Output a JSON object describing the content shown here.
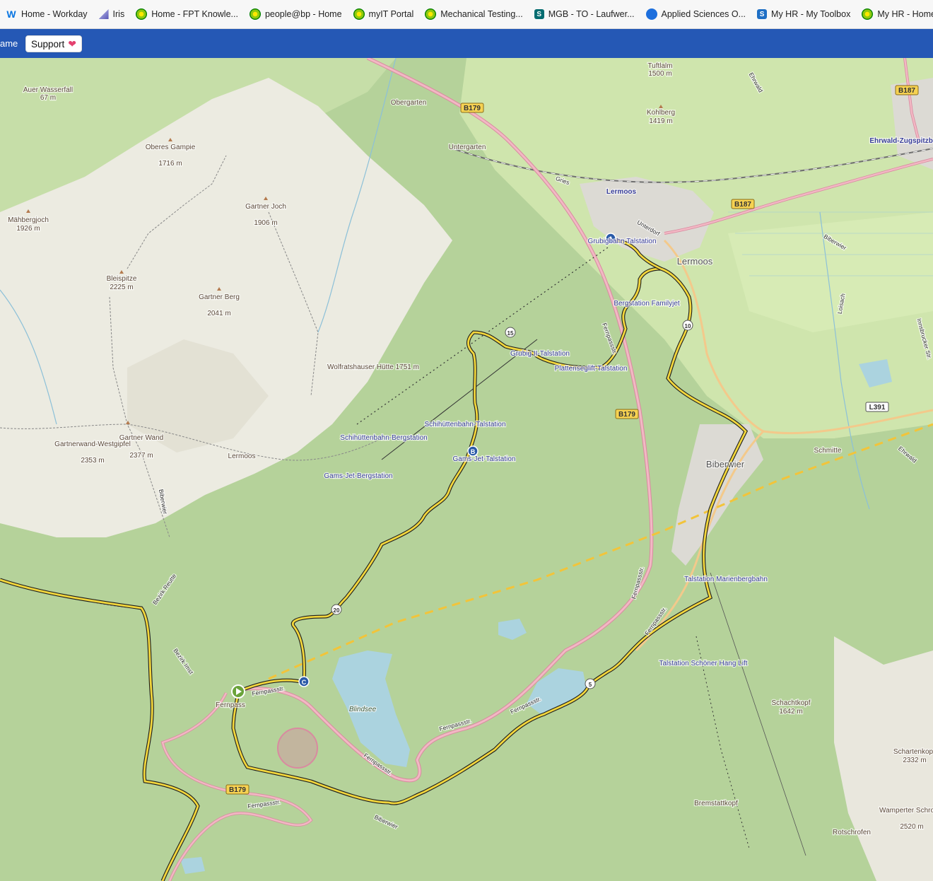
{
  "bookmarks": [
    {
      "label": "Home - Workday",
      "icon": "workday-icon"
    },
    {
      "label": "Iris",
      "icon": "iris-icon"
    },
    {
      "label": "Home - FPT Knowle...",
      "icon": "bp-icon"
    },
    {
      "label": "people@bp - Home",
      "icon": "bp-icon"
    },
    {
      "label": "myIT Portal",
      "icon": "bp-icon"
    },
    {
      "label": "Mechanical Testing...",
      "icon": "bp-icon"
    },
    {
      "label": "MGB - TO - Laufwer...",
      "icon": "sharepoint-icon"
    },
    {
      "label": "Applied Sciences O...",
      "icon": "globe-icon"
    },
    {
      "label": "My HR - My Toolbox",
      "icon": "sharepoint-icon"
    },
    {
      "label": "My HR - Home",
      "icon": "bp-icon"
    }
  ],
  "appbar": {
    "left_text": "ame",
    "support_label": "Support",
    "support_icon": "heart-icon",
    "color": "#2558b5"
  },
  "map": {
    "route_color": "#f2d63c",
    "markers": [
      {
        "id": "A",
        "label": "A",
        "type": "waypoint"
      },
      {
        "id": "B",
        "label": "B",
        "type": "waypoint"
      },
      {
        "id": "C",
        "label": "C",
        "type": "waypoint"
      },
      {
        "id": "start",
        "label": "",
        "type": "start-icon"
      }
    ],
    "km_markers": [
      "5",
      "10",
      "15",
      "20"
    ],
    "road_shields": [
      "B179",
      "B179",
      "B179",
      "B187",
      "B187",
      "L391"
    ],
    "peaks": [
      {
        "name": "Tuftlalm",
        "elev": "1500 m"
      },
      {
        "name": "Kohlberg",
        "elev": "1419 m"
      },
      {
        "name": "Oberes Gampie",
        "elev": "1716 m"
      },
      {
        "name": "Gartner Joch",
        "elev": "1906 m"
      },
      {
        "name": "Mähbergjoch",
        "elev": "1926 m"
      },
      {
        "name": "Bleispitze",
        "elev": "2225 m"
      },
      {
        "name": "Gartner Berg",
        "elev": "2041 m"
      },
      {
        "name": "Gartnerwand-Westgipfel",
        "elev": "2353 m"
      },
      {
        "name": "Gartner Wand",
        "elev": "2377 m"
      },
      {
        "name": "Schachtkopf",
        "elev": "1642 m"
      },
      {
        "name": "Schartenkop",
        "elev": "2332 m"
      },
      {
        "name": "Wamperter Schrofen",
        "elev": "2520 m"
      },
      {
        "name": "Auer Wasserfall",
        "elev": "67 m"
      }
    ],
    "places": [
      "Obergarten",
      "Untergarten",
      "Lermoos",
      "Lermoos",
      "Biberwier",
      "Schmitte",
      "Ehrwald-Zugspitzbahn",
      "Fernpass",
      "Gries",
      "Unterdorf",
      "Bremstattkopf",
      "Rotschrofen",
      "Blindsee",
      "Lermoos"
    ],
    "stations": [
      "Grubigbahn Talstation",
      "Bergstation Familyjet",
      "Grubig II-Talstation",
      "Plattenseglift-Talstation",
      "Schihüttenbahn-Talstation",
      "Schihüttenbahn-Bergstation",
      "Gams-Jet-Talstation",
      "Gams-Jet-Bergstation",
      "Talstation Marienbergbahn",
      "Talstation Schöner Hang Lift",
      "Wolfratshauser Hütte 1751 m"
    ],
    "streets": [
      "Fernpassstr.",
      "Fernpassstr.",
      "Fernpassstr.",
      "Fernpassstr.",
      "Fernpassstr.",
      "Fernpassstr.",
      "Fernpassstr.",
      "Fernpassstr.",
      "Bezirk Reutte",
      "Bezirk Imst",
      "Biberwier",
      "Biberwier",
      "Ehrwald",
      "Ehrwald",
      "Loisach",
      "Biberwier",
      "Innsbrucker Str."
    ]
  }
}
